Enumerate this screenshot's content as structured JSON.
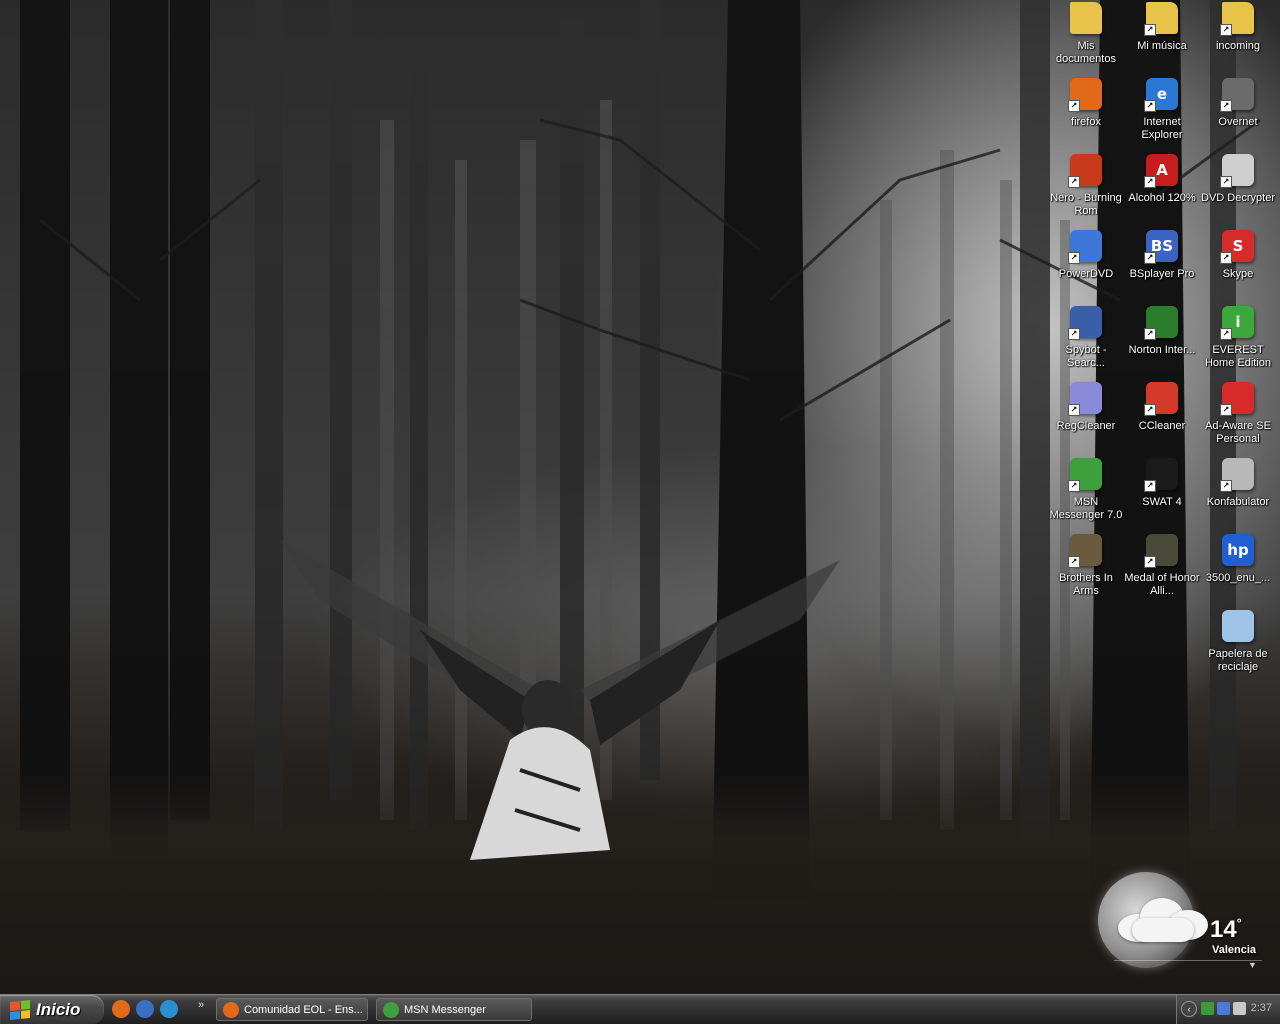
{
  "desktop": {
    "icons": [
      {
        "label": "Mis documentos",
        "icon": "my-documents-folder-icon",
        "color": "#e8c34a",
        "glyph": "",
        "shortcut": false
      },
      {
        "label": "Mi música",
        "icon": "my-music-folder-icon",
        "color": "#e8c34a",
        "glyph": "",
        "shortcut": true
      },
      {
        "label": "incoming",
        "icon": "folder-icon",
        "color": "#e8c34a",
        "glyph": "",
        "shortcut": true
      },
      {
        "label": "firefox",
        "icon": "firefox-icon",
        "color": "#e06a1a",
        "glyph": "",
        "shortcut": true
      },
      {
        "label": "Internet Explorer",
        "icon": "internet-explorer-icon",
        "color": "#2c76d4",
        "glyph": "e",
        "shortcut": true
      },
      {
        "label": "Overnet",
        "icon": "overnet-icon",
        "color": "#6b6b6b",
        "glyph": "",
        "shortcut": true
      },
      {
        "label": "Nero - Burning Rom",
        "icon": "nero-burning-rom-icon",
        "color": "#c93a1a",
        "glyph": "",
        "shortcut": true
      },
      {
        "label": "Alcohol 120%",
        "icon": "alcohol-120-icon",
        "color": "#c81d1d",
        "glyph": "A",
        "shortcut": true
      },
      {
        "label": "DVD Decrypter",
        "icon": "dvd-decrypter-icon",
        "color": "#cfcfcf",
        "glyph": "",
        "shortcut": true
      },
      {
        "label": "PowerDVD",
        "icon": "powerdvd-icon",
        "color": "#3d78d8",
        "glyph": "",
        "shortcut": true
      },
      {
        "label": "BSplayer Pro",
        "icon": "bsplayer-icon",
        "color": "#3b63c2",
        "glyph": "BS",
        "shortcut": true
      },
      {
        "label": "Skype",
        "icon": "skype-icon",
        "color": "#d52b2b",
        "glyph": "S",
        "shortcut": true
      },
      {
        "label": "Spybot - Searc...",
        "icon": "spybot-icon",
        "color": "#3a5fa8",
        "glyph": "",
        "shortcut": true
      },
      {
        "label": "Norton Inter...",
        "icon": "norton-globe-icon",
        "color": "#2b7d2b",
        "glyph": "",
        "shortcut": true
      },
      {
        "label": "EVEREST Home Edition",
        "icon": "everest-info-icon",
        "color": "#3aa83a",
        "glyph": "i",
        "shortcut": true
      },
      {
        "label": "RegCleaner",
        "icon": "regcleaner-icon",
        "color": "#8a8ad8",
        "glyph": "",
        "shortcut": true
      },
      {
        "label": "CCleaner",
        "icon": "ccleaner-icon",
        "color": "#d43a2a",
        "glyph": "",
        "shortcut": true
      },
      {
        "label": "Ad-Aware SE Personal",
        "icon": "ad-aware-icon",
        "color": "#d82a2a",
        "glyph": "",
        "shortcut": true
      },
      {
        "label": "MSN Messenger 7.0",
        "icon": "msn-messenger-icon",
        "color": "#3da03d",
        "glyph": "",
        "shortcut": true
      },
      {
        "label": "SWAT 4",
        "icon": "swat4-icon",
        "color": "#1a1a1a",
        "glyph": "",
        "shortcut": true
      },
      {
        "label": "Konfabulator",
        "icon": "konfabulator-icon",
        "color": "#b8b8b8",
        "glyph": "",
        "shortcut": true
      },
      {
        "label": "Brothers In Arms",
        "icon": "brothers-in-arms-icon",
        "color": "#6a5a3e",
        "glyph": "",
        "shortcut": true
      },
      {
        "label": "Medal of Honor Alli...",
        "icon": "medal-of-honor-icon",
        "color": "#4a4a3a",
        "glyph": "",
        "shortcut": true
      },
      {
        "label": "3500_enu_...",
        "icon": "hp-installer-icon",
        "color": "#1f5fd1",
        "glyph": "hp",
        "shortcut": false
      },
      {
        "label": "Papelera de reciclaje",
        "icon": "recycle-bin-icon",
        "color": "#9fc4e8",
        "glyph": "",
        "shortcut": false
      }
    ]
  },
  "weather": {
    "temperature": "14",
    "degree": "°",
    "city": "Valencia",
    "icon": "cloudy-moon-icon"
  },
  "taskbar": {
    "start_label": "Inicio",
    "quick_launch": [
      {
        "icon": "firefox-icon",
        "color": "#e06a1a"
      },
      {
        "icon": "show-desktop-icon",
        "color": "#3b6fc4"
      },
      {
        "icon": "media-player-icon",
        "color": "#2a8fd0"
      }
    ],
    "quick_launch_more": "»",
    "tasks": [
      {
        "label": "Comunidad EOL - Ens...",
        "icon": "firefox-icon",
        "color": "#e06a1a"
      },
      {
        "label": "MSN Messenger",
        "icon": "msn-messenger-icon",
        "color": "#3da03d"
      }
    ],
    "tray": {
      "expand": "‹",
      "icons": [
        "network-icon",
        "msn-tray-icon",
        "volume-icon"
      ],
      "clock": "2:37"
    }
  }
}
